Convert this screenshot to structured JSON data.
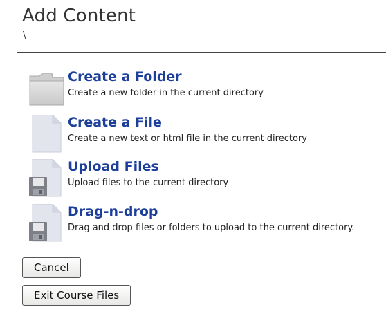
{
  "header": {
    "title": "Add Content",
    "path": "\\"
  },
  "actions": [
    {
      "label": "Create a Folder",
      "description": "Create a new folder in the current directory",
      "icon": "folder-icon"
    },
    {
      "label": "Create a File",
      "description": "Create a new text or html file in the current directory",
      "icon": "file-icon"
    },
    {
      "label": "Upload Files",
      "description": "Upload files to the current directory",
      "icon": "upload-disk-icon"
    },
    {
      "label": "Drag-n-drop",
      "description": "Drag and drop files or folders to upload to the current directory.",
      "icon": "drag-drop-disk-icon"
    }
  ],
  "buttons": {
    "cancel": "Cancel",
    "exit": "Exit Course Files"
  },
  "colors": {
    "link": "#1d3f9c",
    "rule": "#444444",
    "icon_fill": "#dfe2ea"
  }
}
